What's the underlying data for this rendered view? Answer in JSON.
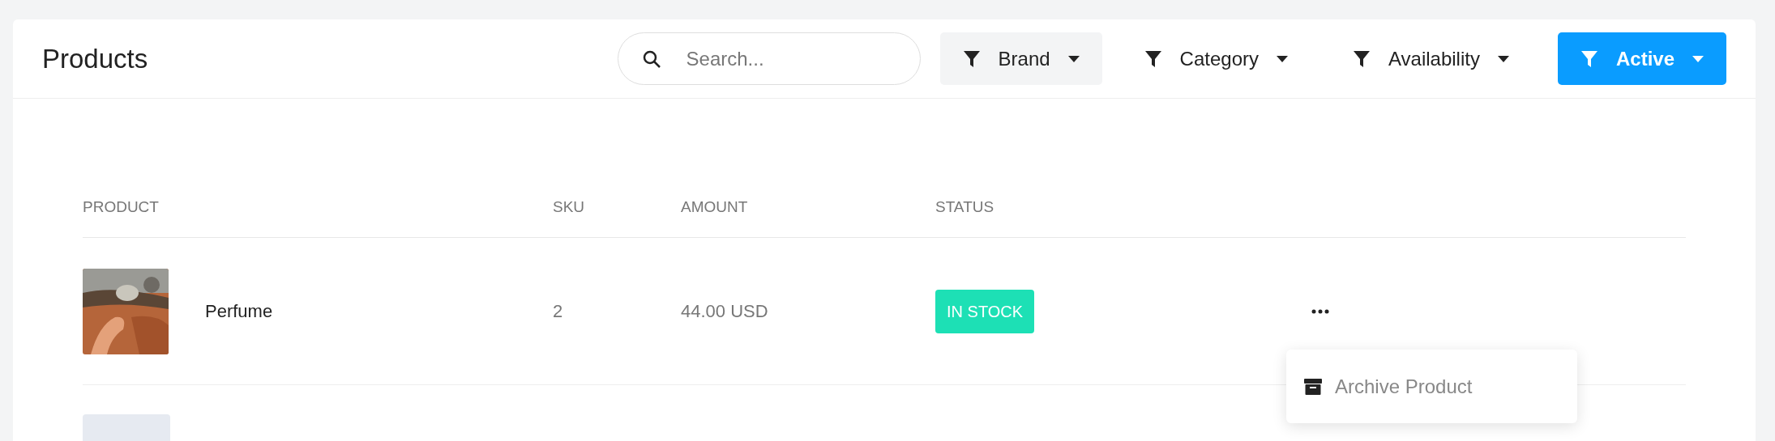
{
  "header": {
    "title": "Products"
  },
  "search": {
    "placeholder": "Search..."
  },
  "filters": [
    {
      "label": "Brand",
      "highlighted": true,
      "selected": false
    },
    {
      "label": "Category",
      "highlighted": false,
      "selected": false
    },
    {
      "label": "Availability",
      "highlighted": false,
      "selected": false
    },
    {
      "label": "Active",
      "highlighted": false,
      "selected": true
    }
  ],
  "table": {
    "columns": [
      "PRODUCT",
      "SKU",
      "AMOUNT",
      "STATUS"
    ],
    "rows": [
      {
        "name": "Perfume",
        "sku": "2",
        "amount": "44.00 USD",
        "status": "IN STOCK",
        "color": "#1de0b5"
      },
      {
        "kind": "placeholder"
      }
    ]
  },
  "row_menu": {
    "items": [
      "Archive Product"
    ]
  }
}
